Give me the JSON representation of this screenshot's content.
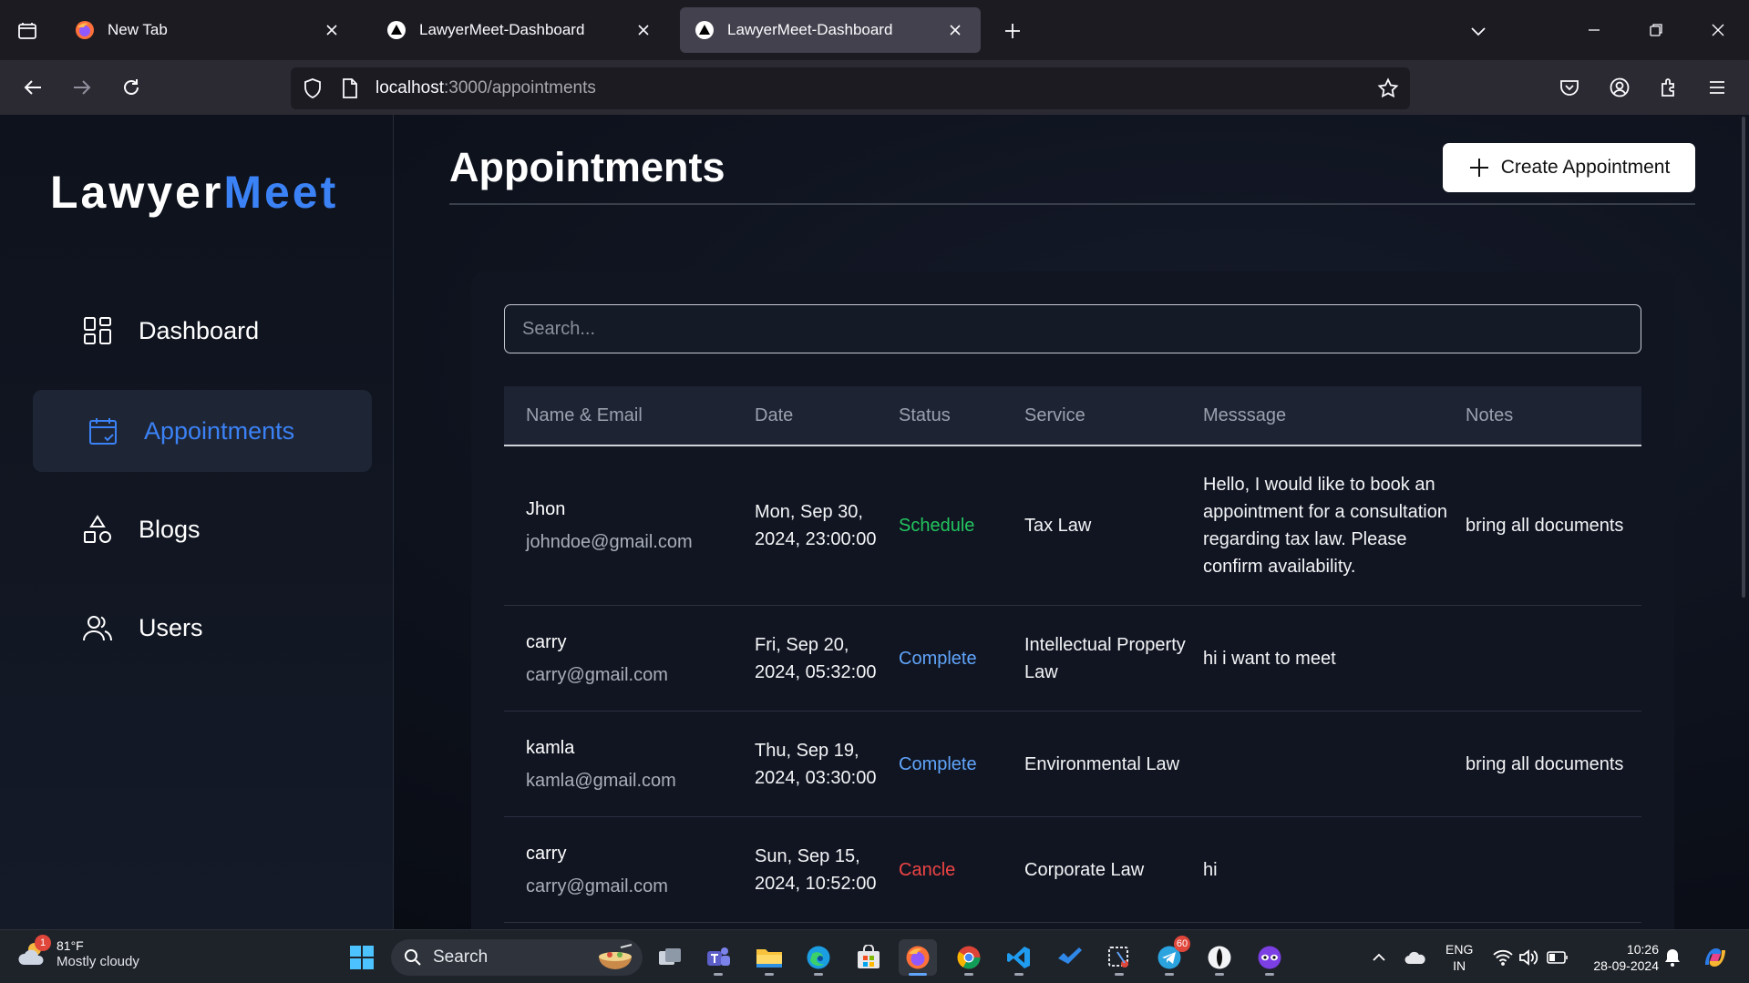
{
  "browser": {
    "tabs": [
      {
        "label": "New Tab",
        "icon": "firefox-icon",
        "active": false
      },
      {
        "label": "LawyerMeet-Dashboard",
        "icon": "triangle-favicon-icon",
        "active": false
      },
      {
        "label": "LawyerMeet-Dashboard",
        "icon": "triangle-favicon-icon",
        "active": true
      }
    ],
    "url_host": "localhost",
    "url_path": ":3000/appointments"
  },
  "sidebar": {
    "logo_part1": "Lawyer",
    "logo_part2": "Meet",
    "items": [
      {
        "label": "Dashboard",
        "icon": "dashboard-grid-icon",
        "active": false
      },
      {
        "label": "Appointments",
        "icon": "calendar-icon",
        "active": true
      },
      {
        "label": "Blogs",
        "icon": "shapes-icon",
        "active": false
      },
      {
        "label": "Users",
        "icon": "users-icon",
        "active": false
      }
    ]
  },
  "main": {
    "title": "Appointments",
    "create_label": "Create Appointment",
    "search_placeholder": "Search..."
  },
  "table": {
    "headers": [
      "Name & Email",
      "Date",
      "Status",
      "Service",
      "Messsage",
      "Notes"
    ],
    "rows": [
      {
        "name": "Jhon",
        "email": "johndoe@gmail.com",
        "date": "Mon, Sep 30, 2024, 23:00:00",
        "status": "Schedule",
        "service": "Tax Law",
        "message": "Hello, I would like to book an appointment for a consultation regarding tax law. Please confirm availability.",
        "notes": "bring all documents"
      },
      {
        "name": "carry",
        "email": "carry@gmail.com",
        "date": "Fri, Sep 20, 2024, 05:32:00",
        "status": "Complete",
        "service": "Intellectual Property Law",
        "message": "hi i want to meet",
        "notes": ""
      },
      {
        "name": "kamla",
        "email": "kamla@gmail.com",
        "date": "Thu, Sep 19, 2024, 03:30:00",
        "status": "Complete",
        "service": "Environmental Law",
        "message": "",
        "notes": "bring all documents"
      },
      {
        "name": "carry",
        "email": "carry@gmail.com",
        "date": "Sun, Sep 15, 2024, 10:52:00",
        "status": "Cancle",
        "service": "Corporate Law",
        "message": "hi",
        "notes": ""
      }
    ]
  },
  "colors": {
    "accent": "#3b82f6",
    "status_schedule": "#22c55e",
    "status_complete": "#60a5fa",
    "status_cancle": "#ef4444"
  },
  "taskbar": {
    "weather_temp": "81°F",
    "weather_cond": "Mostly cloudy",
    "weather_badge": "1",
    "search_label": "Search",
    "telegram_badge": "60",
    "lang_line1": "ENG",
    "lang_line2": "IN",
    "time": "10:26",
    "date": "28-09-2024"
  }
}
